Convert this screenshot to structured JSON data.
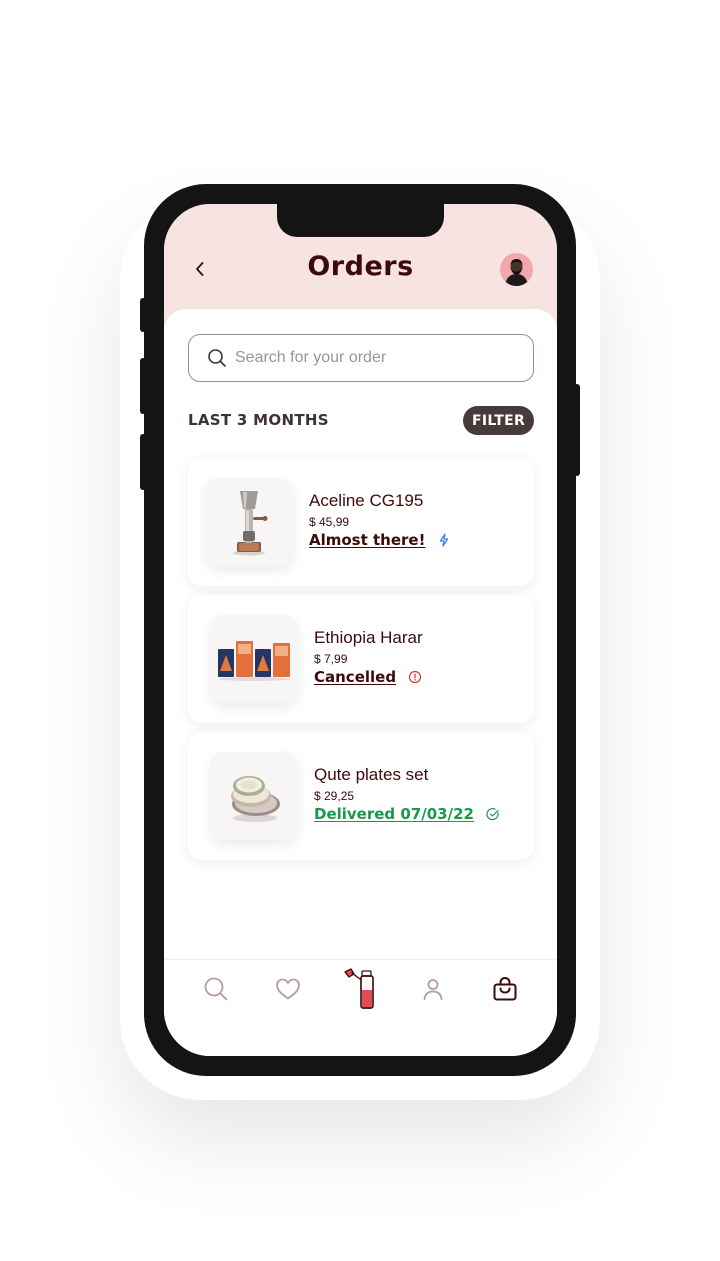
{
  "header": {
    "title": "Orders",
    "back_icon": "chevron-left-icon",
    "avatar_icon": "user-avatar"
  },
  "search": {
    "placeholder": "Search for your order",
    "icon": "search-icon"
  },
  "section": {
    "label": "LAST 3 MONTHS",
    "filter_label": "FILTER"
  },
  "orders": [
    {
      "name": "Aceline CG195",
      "price": "$ 45,99",
      "status": "Almost there!",
      "status_color": "#3b0a0a",
      "status_icon": "lightning-icon",
      "status_icon_color": "#2f80ed",
      "image": "coffee-grinder-image"
    },
    {
      "name": "Ethiopia Harar",
      "price": "$ 7,99",
      "status": "Cancelled",
      "status_color": "#3b0a0a",
      "status_icon": "alert-circle-icon",
      "status_icon_color": "#d13b3b",
      "image": "coffee-bags-image"
    },
    {
      "name": "Qute plates set",
      "price": "$ 29,25",
      "status": "Delivered 07/03/22",
      "status_color": "#179a4a",
      "status_icon": "check-circle-icon",
      "status_icon_color": "#179a4a",
      "image": "plates-image"
    }
  ],
  "bottom_nav": {
    "items": [
      "search-icon",
      "heart-icon",
      "coffee-grinder-icon",
      "user-icon",
      "shopping-bag-icon"
    ]
  },
  "colors": {
    "header_bg": "#f8e3e3",
    "primary_text": "#3b0a0a",
    "filter_bg": "#463a3a",
    "accent_red": "#e04b54"
  }
}
